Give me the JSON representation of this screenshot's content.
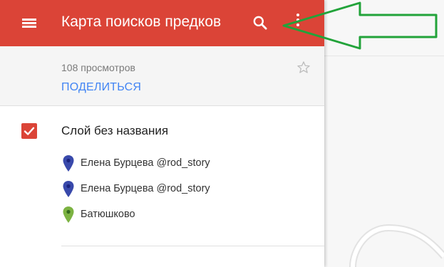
{
  "app_bar": {
    "title": "Карта поисков предков",
    "menu_icon": "menu-icon",
    "search_icon": "search-icon",
    "more_icon": "more-vert-icon",
    "color": "#db4437"
  },
  "info": {
    "views": "108 просмотров",
    "share": "ПОДЕЛИТЬСЯ",
    "star_icon": "star-outline-icon"
  },
  "layer": {
    "checked": true,
    "title": "Слой без названия",
    "items": [
      {
        "label": "Елена Бурцева @rod_story",
        "pin_color": "#3949ab"
      },
      {
        "label": "Елена Бурцева @rod_story",
        "pin_color": "#3949ab"
      },
      {
        "label": "Батюшково",
        "pin_color": "#7cb342"
      }
    ]
  },
  "annotation": {
    "arrow_color": "#22a33a"
  }
}
